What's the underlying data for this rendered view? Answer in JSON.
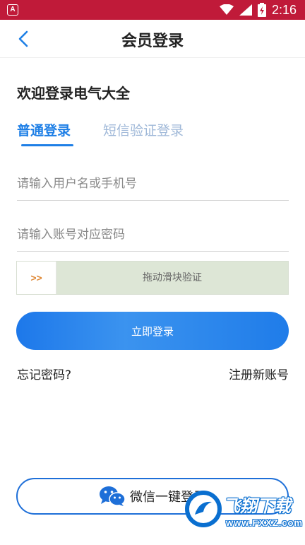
{
  "status_bar": {
    "app_badge": "A",
    "time": "2:16",
    "battery_badge": "8"
  },
  "header": {
    "title": "会员登录"
  },
  "welcome": "欢迎登录电气大全",
  "tabs": [
    {
      "label": "普通登录",
      "active": true
    },
    {
      "label": "短信验证登录",
      "active": false
    }
  ],
  "form": {
    "username_placeholder": "请输入用户名或手机号",
    "password_placeholder": "请输入账号对应密码",
    "slider_handle": ">>",
    "slider_text": "拖动滑块验证",
    "login_label": "立即登录"
  },
  "links": {
    "forgot": "忘记密码?",
    "register": "注册新账号"
  },
  "wechat": {
    "label": "微信一键登录"
  },
  "watermark": {
    "title": "飞翔下载",
    "url": "www.FXXZ.com"
  },
  "colors": {
    "status_bar": "#c01a39",
    "accent": "#1e7fe6",
    "slider_bg": "#dde6d6"
  }
}
